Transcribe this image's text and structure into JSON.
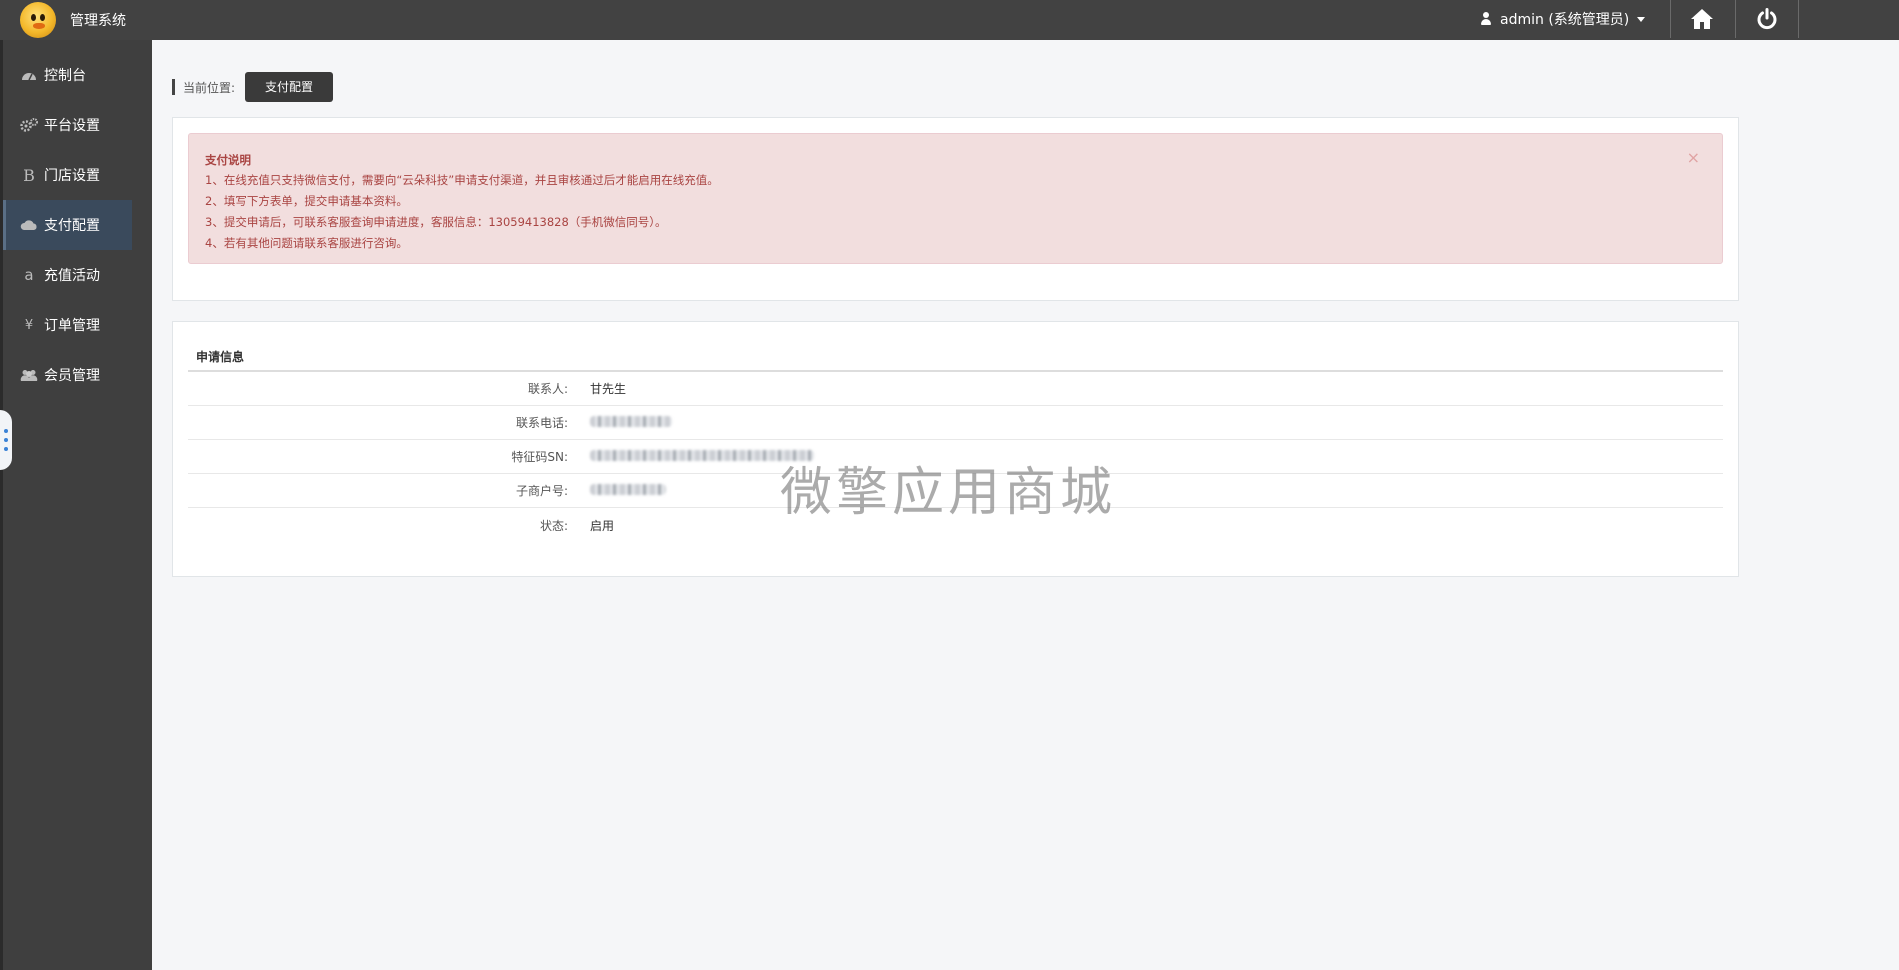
{
  "header": {
    "brand": "管理系统",
    "user": "admin (系统管理员)",
    "home_icon": "home-icon",
    "power_icon": "power-icon"
  },
  "sidebar": {
    "items": [
      {
        "label": "控制台",
        "icon": "dashboard-icon"
      },
      {
        "label": "平台设置",
        "icon": "gears-icon"
      },
      {
        "label": "门店设置",
        "icon": "bold-b-icon"
      },
      {
        "label": "支付配置",
        "icon": "cloud-icon",
        "active": true
      },
      {
        "label": "充值活动",
        "icon": "amazon-a-icon"
      },
      {
        "label": "订单管理",
        "icon": "yen-icon"
      },
      {
        "label": "会员管理",
        "icon": "users-icon"
      }
    ]
  },
  "breadcrumb": {
    "label": "当前位置:",
    "current": "支付配置"
  },
  "notice": {
    "title": "支付说明",
    "lines": [
      "1、在线充值只支持微信支付，需要向“云朵科技”申请支付渠道，并且审核通过后才能启用在线充值。",
      "2、填写下方表单，提交申请基本资料。",
      "3、提交申请后，可联系客服查询申请进度，客服信息：13059413828（手机微信同号）。",
      "4、若有其他问题请联系客服进行咨询。"
    ],
    "close": "×"
  },
  "application": {
    "title": "申请信息",
    "rows": [
      {
        "label": "联系人:",
        "value": "甘先生"
      },
      {
        "label": "联系电话:",
        "value": "",
        "redacted": true
      },
      {
        "label": "特征码SN:",
        "value": "",
        "redacted": true
      },
      {
        "label": "子商户号:",
        "value": "",
        "redacted": true
      },
      {
        "label": "状态:",
        "value": "启用"
      }
    ]
  },
  "watermark": "微擎应用商城",
  "colors": {
    "topbar": "#424242",
    "sidebar": "#3f3f3f",
    "active_item": "#3a4a5c",
    "alert_bg": "#f2dede",
    "alert_text": "#a94442"
  }
}
